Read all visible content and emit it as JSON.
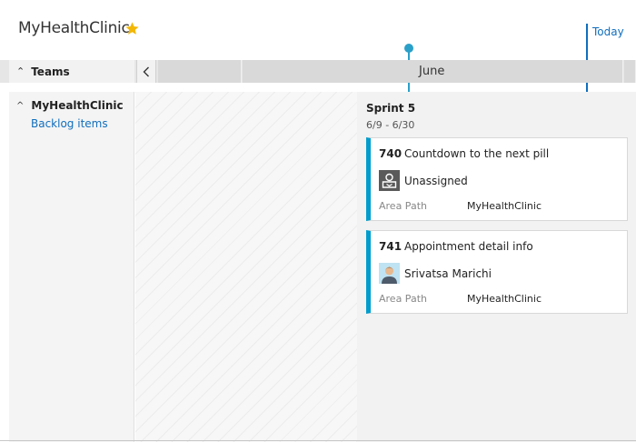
{
  "header": {
    "title": "MyHealthClinic",
    "favorite_icon": "star-icon",
    "today_label": "Today"
  },
  "timeline": {
    "teams_label": "Teams",
    "collapse_icon": "collapse-all-icon",
    "prev_icon": "chevron-left-icon",
    "month": "June"
  },
  "sidebar": {
    "team_name": "MyHealthClinic",
    "expand_icon": "caret-up-icon",
    "backlog_link": "Backlog items"
  },
  "sprint": {
    "name": "Sprint 5",
    "dates": "6/9 - 6/30",
    "cards": [
      {
        "id": "740",
        "title": "Countdown to the next pill",
        "assignee": "Unassigned",
        "avatar_icon": "unassigned-avatar-icon",
        "field_label": "Area Path",
        "field_value": "MyHealthClinic"
      },
      {
        "id": "741",
        "title": "Appointment detail info",
        "assignee": "Srivatsa Marichi",
        "avatar_icon": "user-avatar-icon",
        "field_label": "Area Path",
        "field_value": "MyHealthClinic"
      }
    ]
  },
  "colors": {
    "accent": "#106ebe",
    "card_border": "#009ccc",
    "marker": "#2aa0c9",
    "star": "#f2b705"
  }
}
